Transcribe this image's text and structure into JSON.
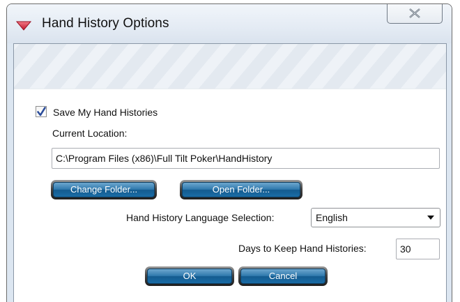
{
  "window": {
    "title": "Hand History Options",
    "close_icon": "close-x-icon",
    "app_icon": "red-triangle-icon",
    "accent": "#d8273a"
  },
  "form": {
    "save_checkbox": {
      "label": "Save My Hand Histories",
      "checked": true
    },
    "current_location_label": "Current Location:",
    "current_location_value": "C:\\Program Files (x86)\\Full Tilt Poker\\HandHistory",
    "change_folder_label": "Change Folder...",
    "open_folder_label": "Open Folder...",
    "language_label": "Hand History Language Selection:",
    "language_value": "English",
    "days_label": "Days to Keep Hand Histories:",
    "days_value": "30",
    "ok_label": "OK",
    "cancel_label": "Cancel"
  },
  "colors": {
    "button_blue": "#2f79ad",
    "banner": "#e8edf3"
  }
}
